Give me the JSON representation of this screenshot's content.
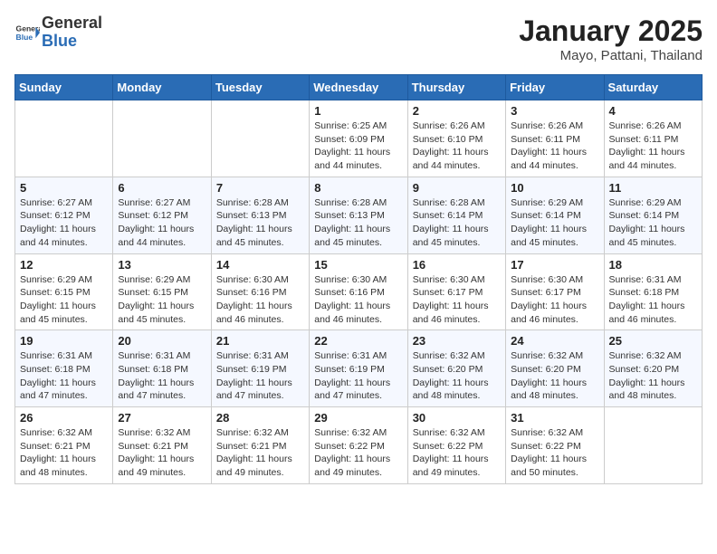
{
  "header": {
    "logo_general": "General",
    "logo_blue": "Blue",
    "month_year": "January 2025",
    "location": "Mayo, Pattani, Thailand"
  },
  "days_of_week": [
    "Sunday",
    "Monday",
    "Tuesday",
    "Wednesday",
    "Thursday",
    "Friday",
    "Saturday"
  ],
  "weeks": [
    [
      {
        "day": "",
        "info": ""
      },
      {
        "day": "",
        "info": ""
      },
      {
        "day": "",
        "info": ""
      },
      {
        "day": "1",
        "info": "Sunrise: 6:25 AM\nSunset: 6:09 PM\nDaylight: 11 hours and 44 minutes."
      },
      {
        "day": "2",
        "info": "Sunrise: 6:26 AM\nSunset: 6:10 PM\nDaylight: 11 hours and 44 minutes."
      },
      {
        "day": "3",
        "info": "Sunrise: 6:26 AM\nSunset: 6:11 PM\nDaylight: 11 hours and 44 minutes."
      },
      {
        "day": "4",
        "info": "Sunrise: 6:26 AM\nSunset: 6:11 PM\nDaylight: 11 hours and 44 minutes."
      }
    ],
    [
      {
        "day": "5",
        "info": "Sunrise: 6:27 AM\nSunset: 6:12 PM\nDaylight: 11 hours and 44 minutes."
      },
      {
        "day": "6",
        "info": "Sunrise: 6:27 AM\nSunset: 6:12 PM\nDaylight: 11 hours and 44 minutes."
      },
      {
        "day": "7",
        "info": "Sunrise: 6:28 AM\nSunset: 6:13 PM\nDaylight: 11 hours and 45 minutes."
      },
      {
        "day": "8",
        "info": "Sunrise: 6:28 AM\nSunset: 6:13 PM\nDaylight: 11 hours and 45 minutes."
      },
      {
        "day": "9",
        "info": "Sunrise: 6:28 AM\nSunset: 6:14 PM\nDaylight: 11 hours and 45 minutes."
      },
      {
        "day": "10",
        "info": "Sunrise: 6:29 AM\nSunset: 6:14 PM\nDaylight: 11 hours and 45 minutes."
      },
      {
        "day": "11",
        "info": "Sunrise: 6:29 AM\nSunset: 6:14 PM\nDaylight: 11 hours and 45 minutes."
      }
    ],
    [
      {
        "day": "12",
        "info": "Sunrise: 6:29 AM\nSunset: 6:15 PM\nDaylight: 11 hours and 45 minutes."
      },
      {
        "day": "13",
        "info": "Sunrise: 6:29 AM\nSunset: 6:15 PM\nDaylight: 11 hours and 45 minutes."
      },
      {
        "day": "14",
        "info": "Sunrise: 6:30 AM\nSunset: 6:16 PM\nDaylight: 11 hours and 46 minutes."
      },
      {
        "day": "15",
        "info": "Sunrise: 6:30 AM\nSunset: 6:16 PM\nDaylight: 11 hours and 46 minutes."
      },
      {
        "day": "16",
        "info": "Sunrise: 6:30 AM\nSunset: 6:17 PM\nDaylight: 11 hours and 46 minutes."
      },
      {
        "day": "17",
        "info": "Sunrise: 6:30 AM\nSunset: 6:17 PM\nDaylight: 11 hours and 46 minutes."
      },
      {
        "day": "18",
        "info": "Sunrise: 6:31 AM\nSunset: 6:18 PM\nDaylight: 11 hours and 46 minutes."
      }
    ],
    [
      {
        "day": "19",
        "info": "Sunrise: 6:31 AM\nSunset: 6:18 PM\nDaylight: 11 hours and 47 minutes."
      },
      {
        "day": "20",
        "info": "Sunrise: 6:31 AM\nSunset: 6:18 PM\nDaylight: 11 hours and 47 minutes."
      },
      {
        "day": "21",
        "info": "Sunrise: 6:31 AM\nSunset: 6:19 PM\nDaylight: 11 hours and 47 minutes."
      },
      {
        "day": "22",
        "info": "Sunrise: 6:31 AM\nSunset: 6:19 PM\nDaylight: 11 hours and 47 minutes."
      },
      {
        "day": "23",
        "info": "Sunrise: 6:32 AM\nSunset: 6:20 PM\nDaylight: 11 hours and 48 minutes."
      },
      {
        "day": "24",
        "info": "Sunrise: 6:32 AM\nSunset: 6:20 PM\nDaylight: 11 hours and 48 minutes."
      },
      {
        "day": "25",
        "info": "Sunrise: 6:32 AM\nSunset: 6:20 PM\nDaylight: 11 hours and 48 minutes."
      }
    ],
    [
      {
        "day": "26",
        "info": "Sunrise: 6:32 AM\nSunset: 6:21 PM\nDaylight: 11 hours and 48 minutes."
      },
      {
        "day": "27",
        "info": "Sunrise: 6:32 AM\nSunset: 6:21 PM\nDaylight: 11 hours and 49 minutes."
      },
      {
        "day": "28",
        "info": "Sunrise: 6:32 AM\nSunset: 6:21 PM\nDaylight: 11 hours and 49 minutes."
      },
      {
        "day": "29",
        "info": "Sunrise: 6:32 AM\nSunset: 6:22 PM\nDaylight: 11 hours and 49 minutes."
      },
      {
        "day": "30",
        "info": "Sunrise: 6:32 AM\nSunset: 6:22 PM\nDaylight: 11 hours and 49 minutes."
      },
      {
        "day": "31",
        "info": "Sunrise: 6:32 AM\nSunset: 6:22 PM\nDaylight: 11 hours and 50 minutes."
      },
      {
        "day": "",
        "info": ""
      }
    ]
  ]
}
